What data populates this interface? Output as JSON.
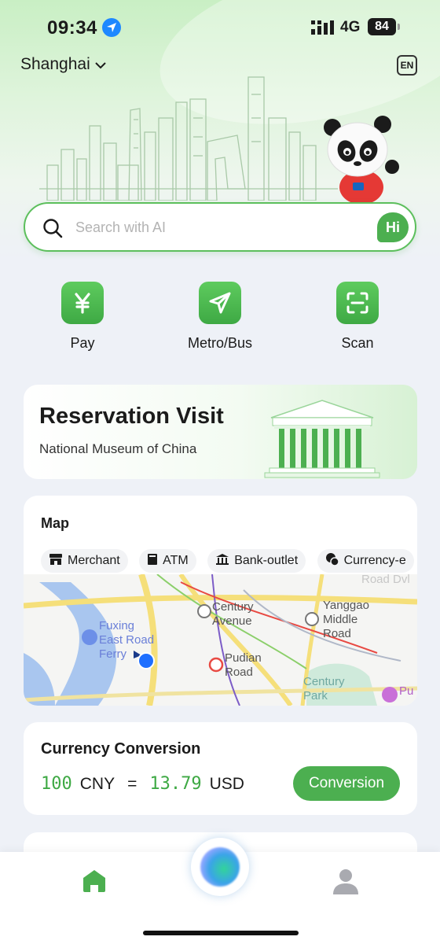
{
  "status_bar": {
    "time": "09:34",
    "network": "4G",
    "battery": "84"
  },
  "header": {
    "city": "Shanghai",
    "language_button": "EN"
  },
  "search": {
    "placeholder": "Search with AI",
    "hi_label": "Hi"
  },
  "quick_actions": [
    {
      "label": "Pay",
      "icon": "yuan-icon"
    },
    {
      "label": "Metro/Bus",
      "icon": "paper-plane-icon"
    },
    {
      "label": "Scan",
      "icon": "scan-icon"
    }
  ],
  "reservation": {
    "title": "Reservation Visit",
    "subtitle": "National Museum of China"
  },
  "map": {
    "title": "Map",
    "chips": [
      "Merchant",
      "ATM",
      "Bank-outlet",
      "Currency-e"
    ],
    "labels": {
      "road_top": "Road Dvl",
      "fuxing": "Fuxing\nEast Road\nFerry",
      "century_avenue": "Century\nAvenue",
      "yanggao": "Yanggao\nMiddle\nRoad",
      "pudian": "Pudian\nRoad",
      "century_park": "Century\nPark",
      "pu": "Pu"
    }
  },
  "currency": {
    "title": "Currency Conversion",
    "amount_from": "100",
    "currency_from": "CNY",
    "equals": "=",
    "amount_to": "13.79",
    "currency_to": "USD",
    "button": "Conversion"
  },
  "colors": {
    "brand_green": "#4caf50",
    "text_dark": "#1b1b1b"
  }
}
